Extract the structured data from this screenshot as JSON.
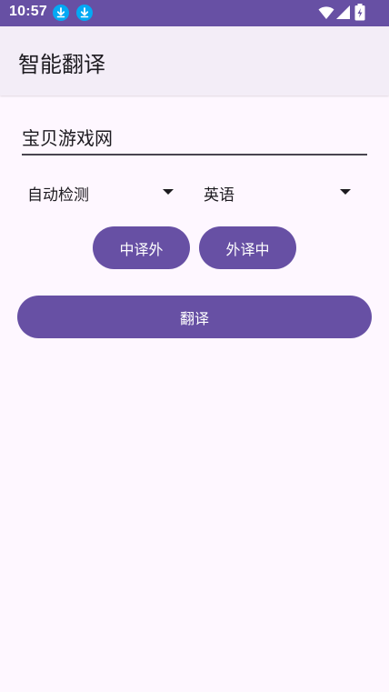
{
  "status_bar": {
    "time": "10:57",
    "icons": [
      "download-icon",
      "download-icon",
      "wifi-icon",
      "signal-icon",
      "battery-charging-icon"
    ]
  },
  "app_bar": {
    "title": "智能翻译"
  },
  "input": {
    "value": "宝贝游戏网"
  },
  "source_lang": {
    "selected": "自动检测"
  },
  "target_lang": {
    "selected": "英语"
  },
  "buttons": {
    "zh_to_foreign": "中译外",
    "foreign_to_zh": "外译中",
    "translate": "翻译"
  },
  "colors": {
    "primary": "#6750A4",
    "surface": "#FEF7FF",
    "app_bar": "#F3EDF7",
    "status_download_badge": "#03A9F4"
  }
}
